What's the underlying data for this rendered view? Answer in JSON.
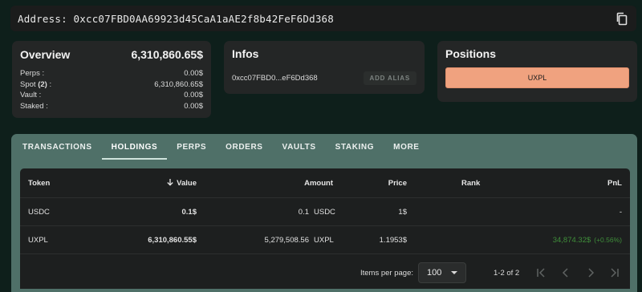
{
  "address": {
    "label": "Address: 0xcc07FBD0AA69923d45CaA1aAE2f8b42FeF6Dd368"
  },
  "overview": {
    "title": "Overview",
    "total": "6,310,860.65$",
    "rows": [
      {
        "label": "Perps :",
        "value": "0.00$"
      },
      {
        "label": "Spot",
        "count": "(2)",
        "suffix": " :",
        "value": "6,310,860.65$"
      },
      {
        "label": "Vault :",
        "value": "0.00$"
      },
      {
        "label": "Staked :",
        "value": "0.00$"
      }
    ]
  },
  "infos": {
    "title": "Infos",
    "address_short": "0xcc07FBD0...eF6Dd368",
    "alias_button": "ADD ALIAS"
  },
  "positions": {
    "title": "Positions",
    "items": [
      "UXPL"
    ]
  },
  "tabs": [
    "TRANSACTIONS",
    "HOLDINGS",
    "PERPS",
    "ORDERS",
    "VAULTS",
    "STAKING",
    "MORE"
  ],
  "active_tab": "HOLDINGS",
  "table": {
    "headers": {
      "token": "Token",
      "value": "Value",
      "amount": "Amount",
      "price": "Price",
      "rank": "Rank",
      "pnl": "PnL"
    },
    "rows": [
      {
        "token": "USDC",
        "value": "0.1$",
        "amount": "0.1",
        "unit": "USDC",
        "price": "1$",
        "rank": "",
        "pnl": "-",
        "pnl_pct": ""
      },
      {
        "token": "UXPL",
        "value": "6,310,860.55$",
        "amount": "5,279,508.56",
        "unit": "UXPL",
        "price": "1.1953$",
        "rank": "",
        "pnl": "34,874.32$",
        "pnl_pct": "(+0.56%)"
      }
    ]
  },
  "pagination": {
    "items_per_page_label": "Items per page:",
    "items_per_page": "100",
    "range": "1-2 of 2"
  },
  "colors": {
    "background": "#0e1f1b",
    "tab_panel": "#4f7068",
    "positions_button": "#f0a27f",
    "pnl_positive": "#3f8e3a"
  }
}
